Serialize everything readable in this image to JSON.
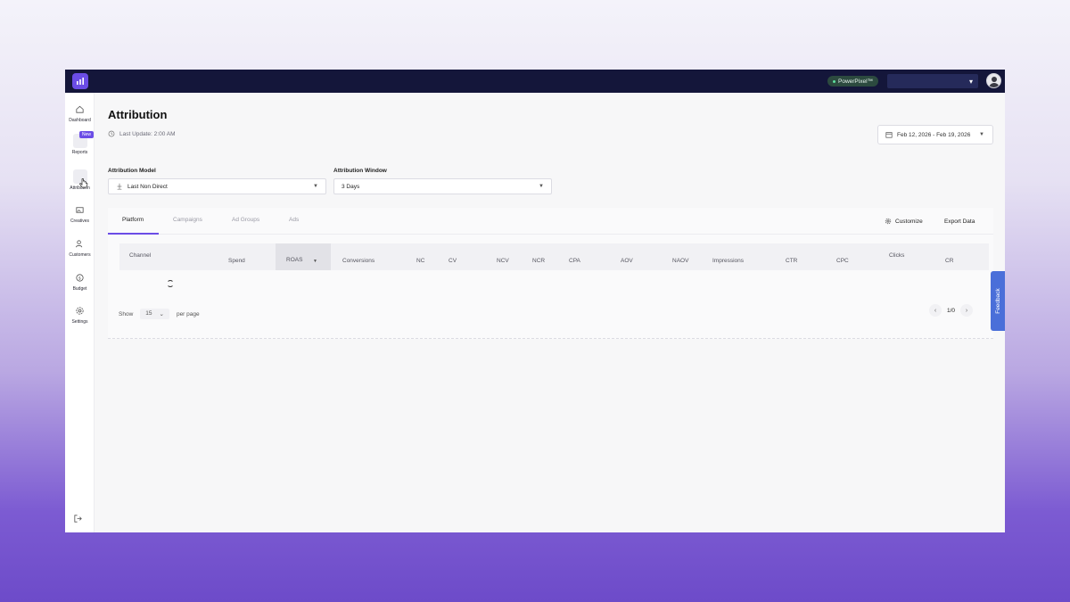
{
  "topbar": {
    "pixel_label": "PowerPixel™",
    "account_caret": "▾",
    "accent_color": "#6b4de6",
    "bar_color": "#14163a"
  },
  "sidebar": {
    "items": [
      {
        "label": "Dashboard",
        "icon": "home-icon"
      },
      {
        "label": "Reports",
        "icon": "report-icon",
        "badge": "New"
      },
      {
        "label": "Attribution",
        "icon": "attribution-icon"
      },
      {
        "label": "Creatives",
        "icon": "creatives-icon"
      },
      {
        "label": "Customers",
        "icon": "customers-icon"
      },
      {
        "label": "Budget",
        "icon": "budget-icon"
      },
      {
        "label": "Settings",
        "icon": "settings-icon"
      }
    ]
  },
  "header": {
    "title": "Attribution",
    "last_update": "Last Update: 2:00 AM",
    "date_range": "Feb 12, 2026 - Feb 19, 2026"
  },
  "filters": {
    "model_label": "Attribution Model",
    "model_value": "Last Non Direct",
    "window_label": "Attribution Window",
    "window_value": "3 Days"
  },
  "tabs": [
    "Platform",
    "Campaigns",
    "Ad Groups",
    "Ads"
  ],
  "actions": {
    "customize": "Customize",
    "export": "Export Data"
  },
  "table": {
    "columns": [
      "Channel",
      "Spend",
      "ROAS",
      "Conversions",
      "NC",
      "CV",
      "NCV",
      "NCR",
      "CPA",
      "AOV",
      "NAOV",
      "Impressions",
      "CTR",
      "CPC",
      "Clicks",
      "CR"
    ]
  },
  "pagination": {
    "show_label": "Show",
    "per_page_value": "15",
    "per_page_caret": "⌄",
    "per_page_label": "per page",
    "page_indicator": "1/0"
  },
  "feedback": "Feedback"
}
